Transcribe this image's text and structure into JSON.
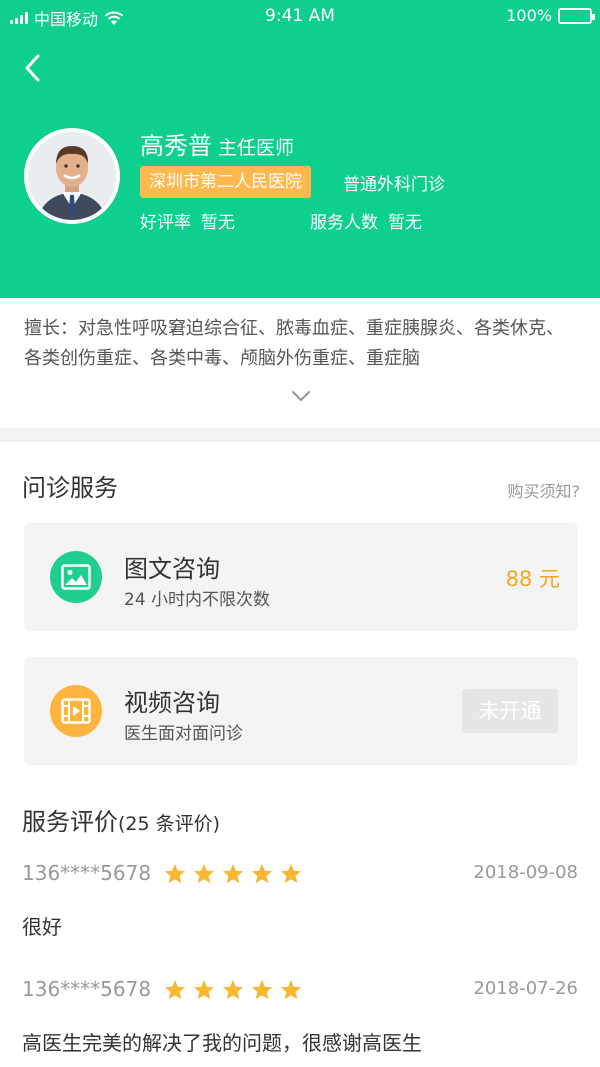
{
  "status_bar": {
    "carrier": "中国移动",
    "time": "9:41 AM",
    "battery": "100%"
  },
  "doctor": {
    "name": "高秀普",
    "title": "主任医师",
    "hospital": "深圳市第二人民医院",
    "department": "普通外科门诊",
    "rating_label": "好评率",
    "rating_value": "暂无",
    "served_label": "服务人数",
    "served_value": "暂无",
    "specialty": "擅长：对急性呼吸窘迫综合征、脓毒血症、重症胰腺炎、各类休克、各类创伤重症、各类中毒、颅脑外伤重症、重症脑"
  },
  "services": {
    "title": "问诊服务",
    "notice": "购买须知?",
    "items": [
      {
        "title": "图文咨询",
        "subtitle": "24 小时内不限次数",
        "price": "88 元",
        "icon": "image-icon",
        "color": "#1fcf8f"
      },
      {
        "title": "视频咨询",
        "subtitle": "医生面对面问诊",
        "status": "未开通",
        "icon": "video-icon",
        "color": "#ffb43d"
      }
    ]
  },
  "reviews": {
    "title": "服务评价",
    "count": "(25 条评价)",
    "items": [
      {
        "user": "136****5678",
        "stars": 5,
        "date": "2018-09-08",
        "text": "很好"
      },
      {
        "user": "136****5678",
        "stars": 5,
        "date": "2018-07-26",
        "text": "高医生完美的解决了我的问题，很感谢高医生"
      }
    ]
  },
  "colors": {
    "header": "#0ecf8e",
    "badge": "#ffb84d",
    "price": "#f5a623",
    "star": "#f7b731"
  }
}
